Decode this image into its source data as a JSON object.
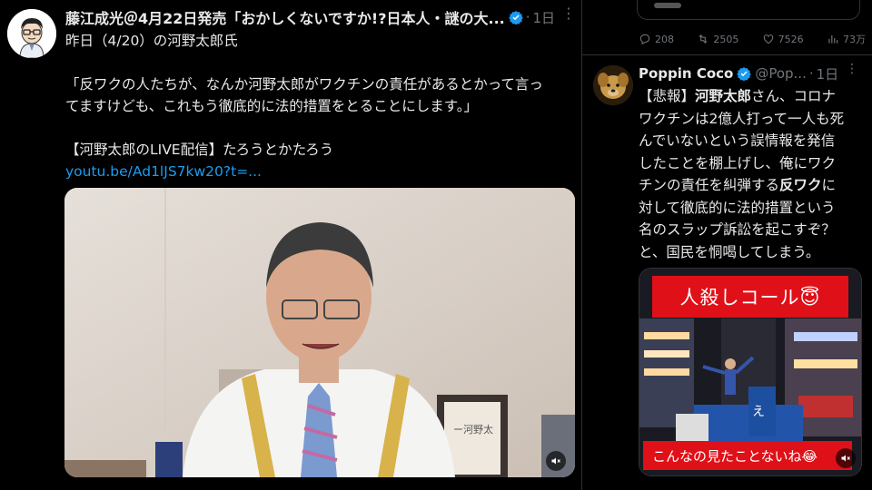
{
  "left_tweet": {
    "author_name": "藤江成光＠4月22日発売「おかしくないですか!?日本人・謎の大...",
    "time": "1日",
    "lines": [
      "昨日（4/20）の河野太郎氏",
      "",
      "「反ワクの人たちが、なんか河野太郎がワクチンの責任があるとかって言っ",
      "てますけども、これもう徹底的に法的措置をとることにします。」",
      "",
      "【河野太郎のLIVE配信】たろうとかたろう"
    ],
    "link": "youtu.be/Ad1lJS7kw20?t=...",
    "video_poster_text": "ー河野太"
  },
  "right_prev_actions": {
    "replies": "208",
    "retweets": "2505",
    "likes": "7526",
    "views": "73万"
  },
  "right_tweet": {
    "author_name": "Poppin Coco",
    "handle": "@Pop...",
    "time": "1日",
    "lines": [
      [
        "【悲報】",
        "河野太郎",
        "さん、コロナ"
      ],
      [
        "ワクチンは2億人打って一人も死",
        "",
        ""
      ],
      [
        "んでいないという誤情報を発信",
        "",
        ""
      ],
      [
        "したことを棚上げし、俺にワク",
        "",
        ""
      ],
      [
        "チンの責任を糾弾する",
        "反ワク",
        "に"
      ],
      [
        "対して徹底的に法的措置という",
        "",
        ""
      ],
      [
        "名のスラップ訴訟を起こすぞ？",
        "",
        ""
      ],
      [
        "と、国民を恫喝してしまう。",
        "",
        ""
      ]
    ],
    "video_caption_top": "人殺しコール😇",
    "video_caption_bottom": "こんなの見たことないね😂"
  },
  "colors": {
    "link": "#1d9bf0",
    "verified": "#1d9bf0",
    "muted_text": "#71767b",
    "banner_red": "#e01018"
  }
}
